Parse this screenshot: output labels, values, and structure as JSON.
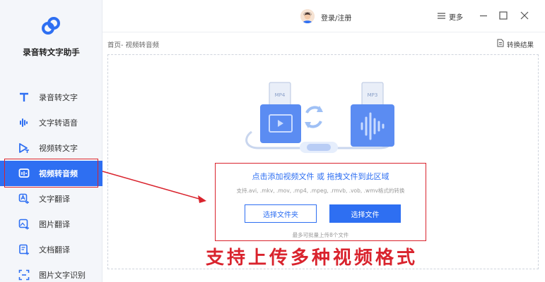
{
  "app": {
    "name": "录音转文字助手"
  },
  "sidebar": {
    "items": [
      {
        "label": "录音转文字",
        "icon": "text-t-icon"
      },
      {
        "label": "文字转语音",
        "icon": "audio-wave-icon"
      },
      {
        "label": "视频转文字",
        "icon": "video-text-icon"
      },
      {
        "label": "视频转音频",
        "icon": "video-audio-icon",
        "active": true
      },
      {
        "label": "文字翻译",
        "icon": "translate-icon"
      },
      {
        "label": "图片翻译",
        "icon": "image-translate-icon"
      },
      {
        "label": "文档翻译",
        "icon": "doc-translate-icon"
      },
      {
        "label": "图片文字识别",
        "icon": "image-ocr-icon"
      }
    ]
  },
  "titlebar": {
    "login": "登录/注册",
    "more": "更多"
  },
  "breadcrumb": "首页- 视频转音频",
  "result_link": "转换结果",
  "upload": {
    "title": "点击添加视频文件 或 拖拽文件到此区域",
    "formats": "支持.avi, .mkv, .mov, .mp4, .mpeg, .rmvb, .vob, .wmv格式的转换",
    "folder_button": "选择文件夹",
    "file_button": "选择文件",
    "limit": "最多可批量上传8个文件"
  },
  "illustration": {
    "left_file_label": "MP4",
    "right_file_label": "MP3"
  },
  "caption": "支持上传多种视频格式",
  "colors": {
    "accent": "#2e6ff2",
    "highlight": "#d9232d",
    "sidebar_bg": "#f4f6fa"
  }
}
